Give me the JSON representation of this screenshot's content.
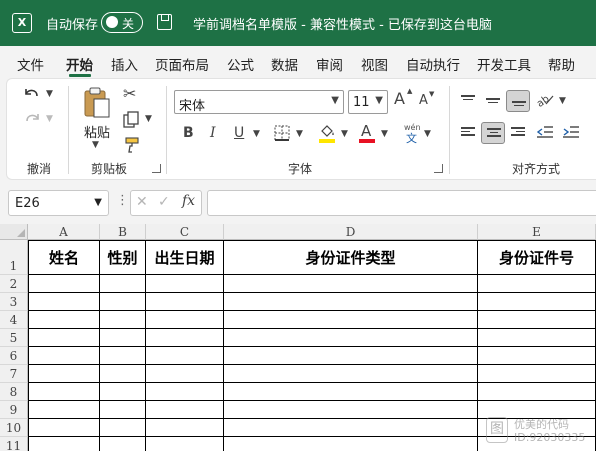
{
  "titlebar": {
    "app_icon": "X",
    "autosave_label": "自动保存",
    "autosave_state": "关",
    "document_title": "学前调档名单模版 - 兼容性模式 - 已保存到这台电脑"
  },
  "menu": {
    "tabs": [
      "文件",
      "开始",
      "插入",
      "页面布局",
      "公式",
      "数据",
      "审阅",
      "视图",
      "自动执行",
      "开发工具",
      "帮助"
    ],
    "active": "开始"
  },
  "ribbon": {
    "undo_group": "撤消",
    "clipboard": {
      "label": "剪贴板",
      "paste": "粘贴"
    },
    "font": {
      "label": "字体",
      "font_name": "宋体",
      "font_size": "11",
      "bold": "B",
      "italic": "I",
      "underline": "U",
      "font_color": "A",
      "phonetic": "wén",
      "phonetic_char": "文",
      "grow": "A",
      "shrink": "A",
      "highlight_color": "#ffe600",
      "font_color_value": "#e81123"
    },
    "alignment": {
      "label": "对齐方式"
    }
  },
  "formula_bar": {
    "name_box": "E26",
    "cancel_icon": "✕",
    "enter_icon": "✓",
    "fx": "fx",
    "formula": ""
  },
  "sheet": {
    "columns": [
      "A",
      "B",
      "C",
      "D",
      "E"
    ],
    "rows": [
      "1",
      "2",
      "3",
      "4",
      "5",
      "6",
      "7",
      "8",
      "9",
      "10",
      "11"
    ],
    "headers": [
      "姓名",
      "性别",
      "出生日期",
      "身份证件类型",
      "身份证件号"
    ]
  },
  "watermark": {
    "logo": "图",
    "line1": "优美的代码",
    "line2": "ID:92030335"
  }
}
